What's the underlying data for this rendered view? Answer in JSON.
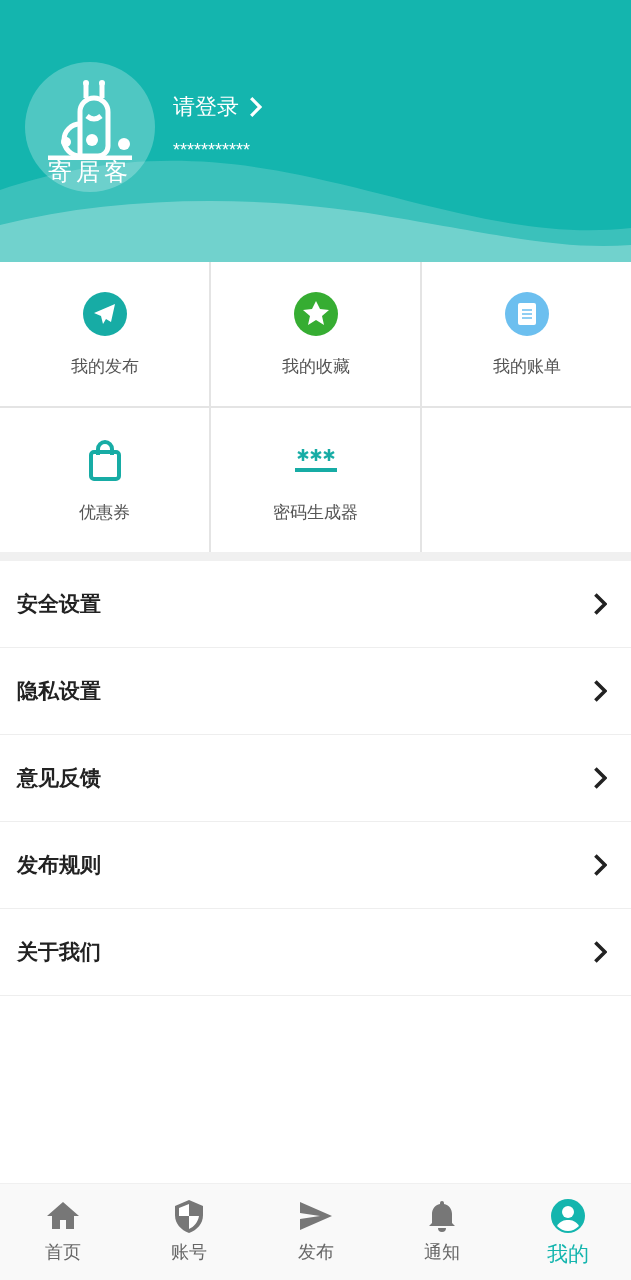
{
  "profile": {
    "logo_text": "寄居客",
    "login": "请登录",
    "account": "***********"
  },
  "shortcuts": [
    {
      "kind": "send",
      "label": "我的发布"
    },
    {
      "kind": "star",
      "label": "我的收藏"
    },
    {
      "kind": "bill",
      "label": "我的账单"
    },
    {
      "kind": "bag",
      "label": "优惠券"
    },
    {
      "kind": "password",
      "label": "密码生成器"
    }
  ],
  "menu": [
    "安全设置",
    "隐私设置",
    "意见反馈",
    "发布规则",
    "关于我们"
  ],
  "tabs": [
    {
      "kind": "home",
      "label": "首页",
      "selected": false
    },
    {
      "kind": "shield",
      "label": "账号",
      "selected": false
    },
    {
      "kind": "send",
      "label": "发布",
      "selected": false
    },
    {
      "kind": "bell",
      "label": "通知",
      "selected": false
    },
    {
      "kind": "user",
      "label": "我的",
      "selected": true
    }
  ]
}
